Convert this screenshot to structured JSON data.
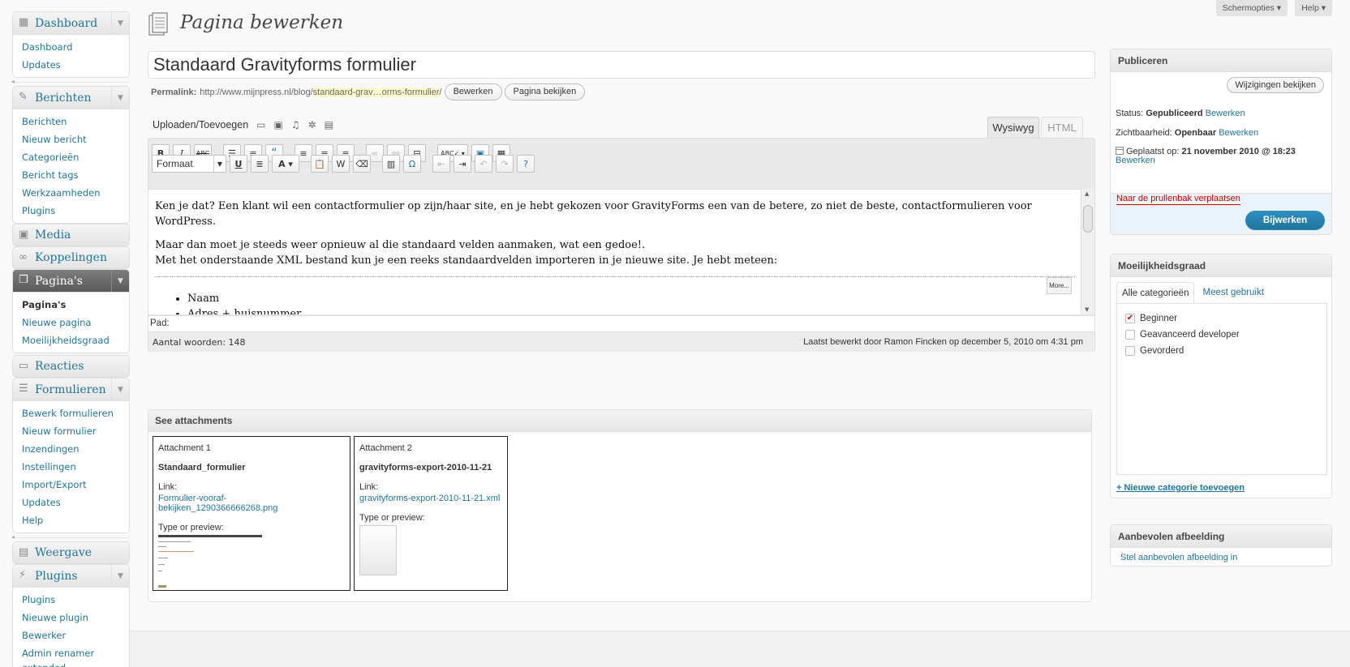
{
  "top": {
    "screen_options": "Schermopties ▾",
    "help": "Help ▾"
  },
  "sidebar": {
    "dashboard": {
      "label": "Dashboard",
      "items": [
        "Dashboard",
        "Updates"
      ]
    },
    "berichten": {
      "label": "Berichten",
      "items": [
        "Berichten",
        "Nieuw bericht",
        "Categorieën",
        "Bericht tags",
        "Werkzaamheden",
        "Plugins"
      ]
    },
    "media": "Media",
    "koppelingen": "Koppelingen",
    "paginas": {
      "label": "Pagina's",
      "items": [
        "Pagina's",
        "Nieuwe pagina",
        "Moeilijkheidsgraad"
      ]
    },
    "reacties": "Reacties",
    "formulieren": {
      "label": "Formulieren",
      "items": [
        "Bewerk formulieren",
        "Nieuw formulier",
        "Inzendingen",
        "Instellingen",
        "Import/Export",
        "Updates",
        "Help"
      ]
    },
    "weergave": "Weergave",
    "plugins": {
      "label": "Plugins",
      "items": [
        "Plugins",
        "Nieuwe plugin",
        "Bewerker",
        "Admin renamer",
        "extended"
      ]
    }
  },
  "page_title": "Pagina bewerken",
  "post_title": "Standaard Gravityforms formulier",
  "permalink": {
    "label": "Permalink:",
    "url_base": "http://www.mijnpress.nl/blog/",
    "slug": "standaard-grav…orms-formulier",
    "slash": "/",
    "edit_button": "Bewerken",
    "view_button": "Pagina bekijken"
  },
  "editor": {
    "upload_label": "Uploaden/Toevoegen",
    "tab_visual": "Wysiwyg",
    "tab_html": "HTML",
    "format_select": "Formaat",
    "content": {
      "p1": "Ken je dat? Een klant wil een contactformulier op zijn/haar site, en je hebt gekozen voor GravityForms een van de betere, zo niet de beste, contactformulieren voor WordPress.",
      "p2a": "Maar dan moet je steeds weer opnieuw al die standaard velden aanmaken, wat een gedoe!.",
      "p2b": "Met het onderstaande XML bestand kun je een reeks standaardvelden importeren in je nieuwe site. Je hebt meteen:",
      "more": "More...",
      "list": [
        "Naam",
        "Adres + huisnummer"
      ]
    },
    "path_label": "Pad:",
    "word_count": "Aantal woorden: 148",
    "last_edited": "Laatst bewerkt door Ramon Fincken op december 5, 2010 om 4:31 pm"
  },
  "attachments": {
    "title": "See attachments",
    "items": [
      {
        "number": "Attachment 1",
        "title": "Standaard_formulier",
        "link_label": "Link:",
        "link": "Formulier-vooraf-bekijken_1290366666268.png",
        "preview_label": "Type or preview:"
      },
      {
        "number": "Attachment 2",
        "title": "gravityforms-export-2010-11-21",
        "link_label": "Link:",
        "link": "gravityforms-export-2010-11-21.xml",
        "preview_label": "Type or preview:"
      }
    ]
  },
  "publish": {
    "title": "Publiceren",
    "preview_button": "Wijzigingen bekijken",
    "status_label": "Status:",
    "status_value": "Gepubliceerd",
    "visibility_label": "Zichtbaarheid:",
    "visibility_value": "Openbaar",
    "date_label": "Geplaatst op:",
    "date_value": "21 november 2010 @ 18:23",
    "edit_link": "Bewerken",
    "trash": "Naar de prullenbak verplaatsen",
    "update_button": "Bijwerken"
  },
  "category": {
    "title": "Moeilijkheidsgraad",
    "tab_all": "Alle categorieën",
    "tab_popular": "Meest gebruikt",
    "items": [
      {
        "label": "Beginner",
        "checked": true
      },
      {
        "label": "Geavanceerd developer",
        "checked": false
      },
      {
        "label": "Gevorderd",
        "checked": false
      }
    ],
    "add_new": "+ Nieuwe categorie toevoegen"
  },
  "featured": {
    "title": "Aanbevolen afbeelding",
    "link": "Stel aanbevolen afbeelding in"
  }
}
